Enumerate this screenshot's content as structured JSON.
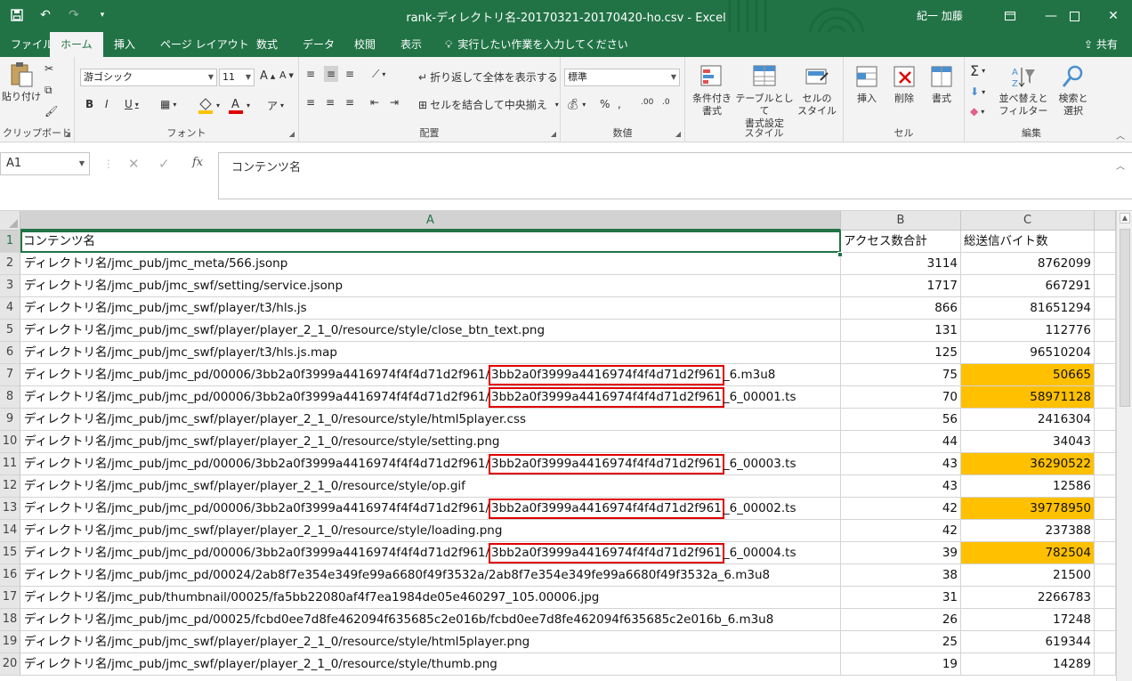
{
  "window": {
    "title": "rank-ディレクトリ名-20170321-20170420-ho.csv  -  Excel",
    "user": "紀一 加藤",
    "qat_icons": [
      "save-icon",
      "undo-icon",
      "redo-icon",
      "customize-icon"
    ]
  },
  "tabs": [
    "ファイル",
    "ホーム",
    "挿入",
    "ページ レイアウト",
    "数式",
    "データ",
    "校閲",
    "表示"
  ],
  "tell_me": "実行したい作業を入力してください",
  "share": "共有",
  "ribbon": {
    "clipboard": {
      "paste": "貼り付け",
      "label": "クリップボード"
    },
    "font": {
      "name": "游ゴシック",
      "size": "11",
      "label": "フォント"
    },
    "alignment": {
      "wrap": "折り返して全体を表示する",
      "merge": "セルを結合して中央揃え",
      "label": "配置"
    },
    "number": {
      "format": "標準",
      "label": "数値"
    },
    "styles": {
      "conditional": "条件付き\n書式",
      "table": "テーブルとして\n書式設定",
      "cell": "セルの\nスタイル",
      "label": "スタイル"
    },
    "cells": {
      "insert": "挿入",
      "delete": "削除",
      "format": "書式",
      "label": "セル"
    },
    "editing": {
      "sort": "並べ替えと\nフィルター",
      "find": "検索と\n選択",
      "label": "編集"
    }
  },
  "formula_bar": {
    "name_box": "A1",
    "content": "コンテンツ名"
  },
  "columns": [
    "A",
    "B",
    "C"
  ],
  "accent": "#217346",
  "highlight_color": "#ffc000",
  "rows": [
    {
      "n": "1",
      "a": "コンテンツ名",
      "b": "アクセス数合計",
      "c": "総送信バイト数",
      "header": true
    },
    {
      "n": "2",
      "a": "ディレクトリ名/jmc_pub/jmc_meta/566.jsonp",
      "b": "3114",
      "c": "8762099"
    },
    {
      "n": "3",
      "a": "ディレクトリ名/jmc_pub/jmc_swf/setting/service.jsonp",
      "b": "1717",
      "c": "667291"
    },
    {
      "n": "4",
      "a": "ディレクトリ名/jmc_pub/jmc_swf/player/t3/hls.js",
      "b": "866",
      "c": "81651294"
    },
    {
      "n": "5",
      "a": "ディレクトリ名/jmc_pub/jmc_swf/player/player_2_1_0/resource/style/close_btn_text.png",
      "b": "131",
      "c": "112776"
    },
    {
      "n": "6",
      "a": "ディレクトリ名/jmc_pub/jmc_swf/player/t3/hls.js.map",
      "b": "125",
      "c": "96510204"
    },
    {
      "n": "7",
      "a_pre": "ディレクトリ名/jmc_pub/jmc_pd/00006/3bb2a0f3999a4416974f4f4d71d2f961/",
      "a_box": "3bb2a0f3999a4416974f4f4d71d2f961",
      "a_post": "_6.m3u8",
      "b": "75",
      "c": "50665",
      "hl": true
    },
    {
      "n": "8",
      "a_pre": "ディレクトリ名/jmc_pub/jmc_pd/00006/3bb2a0f3999a4416974f4f4d71d2f961/",
      "a_box": "3bb2a0f3999a4416974f4f4d71d2f961",
      "a_post": "_6_00001.ts",
      "b": "70",
      "c": "58971128",
      "hl": true
    },
    {
      "n": "9",
      "a": "ディレクトリ名/jmc_pub/jmc_swf/player/player_2_1_0/resource/style/html5player.css",
      "b": "56",
      "c": "2416304"
    },
    {
      "n": "10",
      "a": "ディレクトリ名/jmc_pub/jmc_swf/player/player_2_1_0/resource/style/setting.png",
      "b": "44",
      "c": "34043"
    },
    {
      "n": "11",
      "a_pre": "ディレクトリ名/jmc_pub/jmc_pd/00006/3bb2a0f3999a4416974f4f4d71d2f961/",
      "a_box": "3bb2a0f3999a4416974f4f4d71d2f961",
      "a_post": "_6_00003.ts",
      "b": "43",
      "c": "36290522",
      "hl": true
    },
    {
      "n": "12",
      "a": "ディレクトリ名/jmc_pub/jmc_swf/player/player_2_1_0/resource/style/op.gif",
      "b": "43",
      "c": "12586"
    },
    {
      "n": "13",
      "a_pre": "ディレクトリ名/jmc_pub/jmc_pd/00006/3bb2a0f3999a4416974f4f4d71d2f961/",
      "a_box": "3bb2a0f3999a4416974f4f4d71d2f961",
      "a_post": "_6_00002.ts",
      "b": "42",
      "c": "39778950",
      "hl": true
    },
    {
      "n": "14",
      "a": "ディレクトリ名/jmc_pub/jmc_swf/player/player_2_1_0/resource/style/loading.png",
      "b": "42",
      "c": "237388"
    },
    {
      "n": "15",
      "a_pre": "ディレクトリ名/jmc_pub/jmc_pd/00006/3bb2a0f3999a4416974f4f4d71d2f961/",
      "a_box": "3bb2a0f3999a4416974f4f4d71d2f961",
      "a_post": "_6_00004.ts",
      "b": "39",
      "c": "782504",
      "hl": true
    },
    {
      "n": "16",
      "a": "ディレクトリ名/jmc_pub/jmc_pd/00024/2ab8f7e354e349fe99a6680f49f3532a/2ab8f7e354e349fe99a6680f49f3532a_6.m3u8",
      "b": "38",
      "c": "21500"
    },
    {
      "n": "17",
      "a": "ディレクトリ名/jmc_pub/thumbnail/00025/fa5bb22080af4f7ea1984de05e460297_105.00006.jpg",
      "b": "31",
      "c": "2266783"
    },
    {
      "n": "18",
      "a": "ディレクトリ名/jmc_pub/jmc_pd/00025/fcbd0ee7d8fe462094f635685c2e016b/fcbd0ee7d8fe462094f635685c2e016b_6.m3u8",
      "b": "26",
      "c": "17248"
    },
    {
      "n": "19",
      "a": "ディレクトリ名/jmc_pub/jmc_swf/player/player_2_1_0/resource/style/html5player.png",
      "b": "25",
      "c": "619344"
    },
    {
      "n": "20",
      "a": "ディレクトリ名/jmc_pub/jmc_swf/player/player_2_1_0/resource/style/thumb.png",
      "b": "19",
      "c": "14289"
    }
  ]
}
